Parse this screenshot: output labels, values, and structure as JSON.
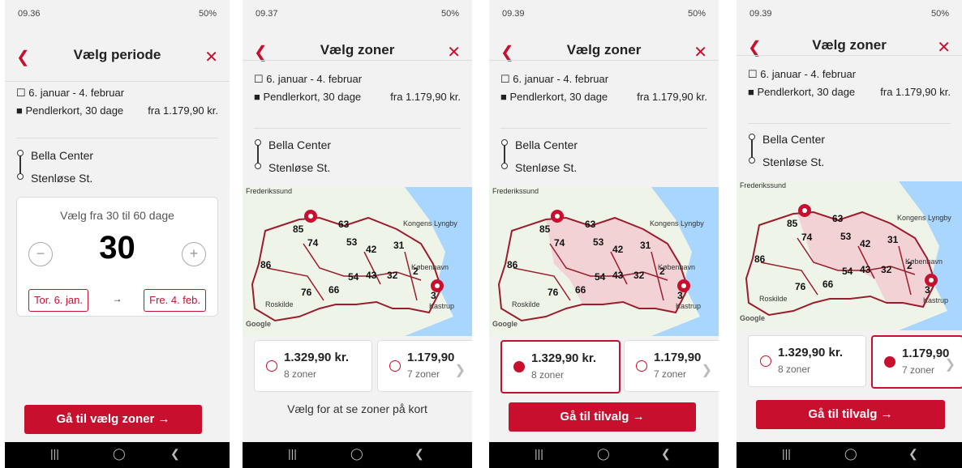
{
  "phones": [
    {
      "time": "09.36",
      "battery": "50%",
      "title": "Vælg periode",
      "date_range": "6. januar - 4. februar",
      "ticket": "Pendlerkort, 30 dage",
      "price_from": "fra 1.179,90 kr.",
      "stops": [
        "Bella Center",
        "Stenløse St."
      ],
      "picker": {
        "label": "Vælg fra 30 til 60 dage",
        "value": "30",
        "start": "Tor. 6. jan.",
        "end": "Fre. 4. feb.",
        "arrow": "→"
      },
      "cta": "Gå til vælg zoner →"
    },
    {
      "time": "09.37",
      "battery": "50%",
      "title": "Vælg zoner",
      "date_range": "6. januar - 4. februar",
      "ticket": "Pendlerkort, 30 dage",
      "price_from": "fra 1.179,90 kr.",
      "stops": [
        "Bella Center",
        "Stenløse St."
      ],
      "options": [
        {
          "price": "1.329,90 kr.",
          "zones": "8 zoner"
        },
        {
          "price": "1.179,90",
          "zones": "7 zoner"
        }
      ],
      "hint": "Vælg for at se zoner på kort"
    },
    {
      "time": "09.39",
      "battery": "50%",
      "title": "Vælg zoner",
      "date_range": "6. januar - 4. februar",
      "ticket": "Pendlerkort, 30 dage",
      "price_from": "fra 1.179,90 kr.",
      "stops": [
        "Bella Center",
        "Stenløse St."
      ],
      "options": [
        {
          "price": "1.329,90 kr.",
          "zones": "8 zoner"
        },
        {
          "price": "1.179,90",
          "zones": "7 zoner"
        }
      ],
      "cta": "Gå til tilvalg →"
    },
    {
      "time": "09.39",
      "battery": "50%",
      "title": "Vælg zoner",
      "date_range": "6. januar - 4. februar",
      "ticket": "Pendlerkort, 30 dage",
      "price_from": "fra 1.179,90 kr.",
      "stops": [
        "Bella Center",
        "Stenløse St."
      ],
      "options": [
        {
          "price": "1.329,90 kr.",
          "zones": "8 zoner"
        },
        {
          "price": "1.179,90",
          "zones": "7 zoner"
        }
      ],
      "cta": "Gå til tilvalg →"
    }
  ],
  "map_labels": [
    "85",
    "74",
    "63",
    "53",
    "42",
    "31",
    "86",
    "76",
    "66",
    "54",
    "43",
    "32",
    "2",
    "3",
    "Roskilde",
    "Kongens Lyngby",
    "København",
    "Kastrup",
    "Frederikssund",
    "Google"
  ],
  "colors": {
    "accent": "#c8102e",
    "map_water": "#a8d6ff",
    "map_land": "#eef5e8"
  }
}
